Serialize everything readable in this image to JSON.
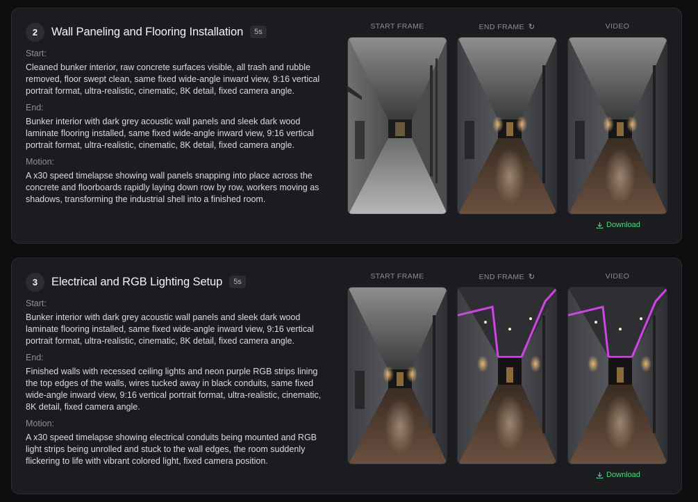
{
  "frame_headers": {
    "start": "START FRAME",
    "end": "END FRAME",
    "video": "VIDEO"
  },
  "download_label": "Download",
  "steps": [
    {
      "number": "2",
      "title": "Wall Paneling and Flooring Installation",
      "duration": "5s",
      "start_label": "Start:",
      "start_text": "Cleaned bunker interior, raw concrete surfaces visible, all trash and rubble removed, floor swept clean, same fixed wide-angle inward view, 9:16 vertical portrait format, ultra-realistic, cinematic, 8K detail, fixed camera angle.",
      "end_label": "End:",
      "end_text": "Bunker interior with dark grey acoustic wall panels and sleek dark wood laminate flooring installed, same fixed wide-angle inward view, 9:16 vertical portrait format, ultra-realistic, cinematic, 8K detail, fixed camera angle.",
      "motion_label": "Motion:",
      "motion_text": "A x30 speed timelapse showing wall panels snapping into place across the concrete and floorboards rapidly laying down row by row, workers moving as shadows, transforming the industrial shell into a finished room."
    },
    {
      "number": "3",
      "title": "Electrical and RGB Lighting Setup",
      "duration": "5s",
      "start_label": "Start:",
      "start_text": "Bunker interior with dark grey acoustic wall panels and sleek dark wood laminate flooring installed, same fixed wide-angle inward view, 9:16 vertical portrait format, ultra-realistic, cinematic, 8K detail, fixed camera angle.",
      "end_label": "End:",
      "end_text": "Finished walls with recessed ceiling lights and neon purple RGB strips lining the top edges of the walls, wires tucked away in black conduits, same fixed wide-angle inward view, 9:16 vertical portrait format, ultra-realistic, cinematic, 8K detail, fixed camera angle.",
      "motion_label": "Motion:",
      "motion_text": "A x30 speed timelapse showing electrical conduits being mounted and RGB light strips being unrolled and stuck to the wall edges, the room suddenly flickering to life with vibrant colored light, fixed camera position."
    }
  ],
  "colors": {
    "accent_download": "#4ade80",
    "neon_purple": "#d946ef",
    "card_bg": "#1b1c1f"
  }
}
